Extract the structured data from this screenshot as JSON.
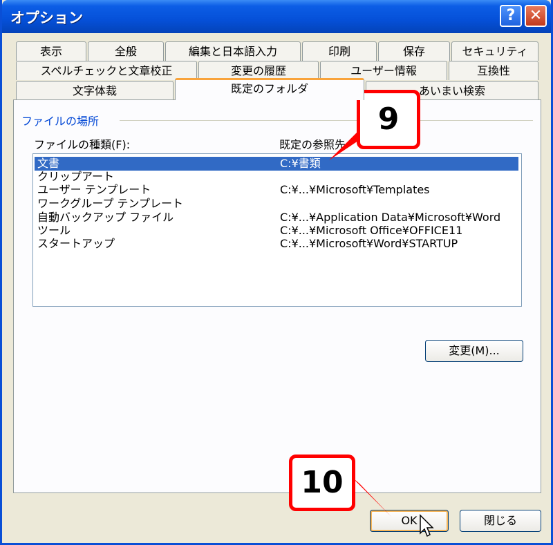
{
  "window": {
    "title": "オプション",
    "help_label": "?",
    "close_label": "✕"
  },
  "tabs": {
    "row1": [
      "表示",
      "全般",
      "編集と日本語入力",
      "印刷",
      "保存",
      "セキュリティ"
    ],
    "row2": [
      "スペルチェックと文章校正",
      "変更の履歴",
      "ユーザー情報",
      "互換性"
    ],
    "row3": [
      "文字体裁",
      "既定のフォルダ",
      "あいまい検索"
    ],
    "active": "既定のフォルダ"
  },
  "panel": {
    "group_title": "ファイルの場所",
    "col_type_label": "ファイルの種類(F):",
    "col_path_label": "既定の参照先",
    "rows": [
      {
        "type": "文書",
        "path": "C:¥書類",
        "selected": true
      },
      {
        "type": "クリップアート",
        "path": ""
      },
      {
        "type": "ユーザー テンプレート",
        "path": "C:¥...¥Microsoft¥Templates"
      },
      {
        "type": "ワークグループ テンプレート",
        "path": ""
      },
      {
        "type": "自動バックアップ ファイル",
        "path": "C:¥...¥Application Data¥Microsoft¥Word"
      },
      {
        "type": "ツール",
        "path": "C:¥...¥Microsoft Office¥OFFICE11"
      },
      {
        "type": "スタートアップ",
        "path": "C:¥...¥Microsoft¥Word¥STARTUP"
      }
    ],
    "change_button": "変更(M)..."
  },
  "buttons": {
    "ok": "OK",
    "close": "閉じる"
  },
  "callouts": {
    "step9": "9",
    "step10": "10"
  },
  "colors": {
    "titlebar": "#0550d8",
    "selection": "#316ac5",
    "callout_border": "#ff0000",
    "tab_active_accent": "#f9a33a"
  }
}
